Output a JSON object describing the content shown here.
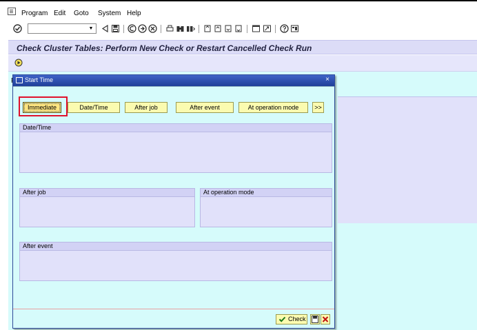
{
  "menu": {
    "items": [
      "Program",
      "Edit",
      "Goto",
      "System",
      "Help"
    ]
  },
  "toolbar": {
    "command_value": "",
    "icons": [
      "enter-icon",
      "back-icon",
      "save-icon",
      "back-green-icon",
      "exit-icon",
      "cancel-icon",
      "print-icon",
      "find-icon",
      "find-next-icon",
      "first-page-icon",
      "previous-page-icon",
      "next-page-icon",
      "last-page-icon",
      "create-session-icon",
      "shortcut-icon",
      "help-icon",
      "layout-icon"
    ]
  },
  "title": "Check Cluster Tables: Perform New Check or Restart Cancelled Check Run",
  "background": {
    "label_fragment": "P"
  },
  "dialog": {
    "title": "Start Time",
    "close": "×",
    "buttons": {
      "immediate": "Immediate",
      "datetime": "Date/Time",
      "after_job": "After job",
      "after_event": "After event",
      "at_operation_mode": "At operation mode",
      "more": ">>"
    },
    "groups": {
      "datetime": "Date/Time",
      "after_job": "After job",
      "at_operation_mode": "At operation mode",
      "after_event": "After event"
    },
    "footer": {
      "check": "Check"
    }
  },
  "colors": {
    "title_bg": "#dcdcf7",
    "work_bg": "#d6fbfb",
    "dialog_title": "#2a4fb0",
    "button_bg": "#fbfbb0",
    "highlight": "#e0102a"
  }
}
